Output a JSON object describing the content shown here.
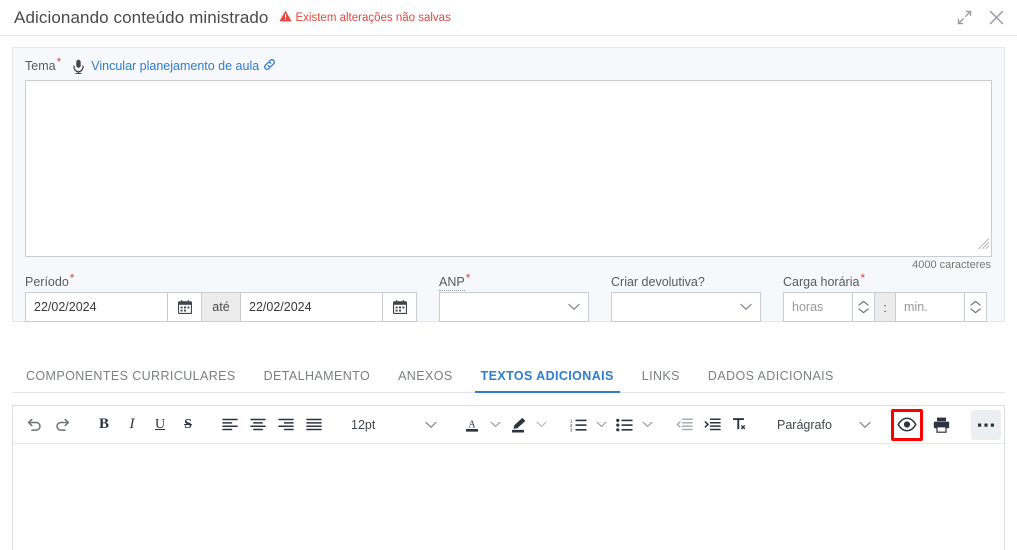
{
  "header": {
    "title": "Adicionando conteúdo ministrado",
    "unsaved_text": "Existem alterações não salvas",
    "unsaved_color": "#e8453c",
    "warning_icon": "warning-triangle-icon",
    "expand_icon": "expand-diagonal-icon",
    "close_icon": "close-x-icon"
  },
  "form": {
    "tema": {
      "label": "Tema",
      "required_mark": "*",
      "mic_icon": "microphone-icon",
      "link_label": "Vincular planejamento de aula",
      "link_icon": "chain-link-icon",
      "link_color": "#2d7dd2",
      "value": "",
      "char_counter": "4000 caracteres",
      "resize_grip_icon": "resize-grip-icon"
    },
    "periodo": {
      "label": "Período",
      "required_mark": "*",
      "start_value": "22/02/2024",
      "separator_label": "até",
      "end_value": "22/02/2024",
      "calendar_icon": "calendar-icon"
    },
    "anp": {
      "label": "ANP",
      "required_mark": "*",
      "value": "",
      "chevron_icon": "chevron-down-icon"
    },
    "devolutiva": {
      "label": "Criar devolutiva?",
      "value": "",
      "chevron_icon": "chevron-down-icon"
    },
    "carga_horaria": {
      "label": "Carga horária",
      "required_mark": "*",
      "hours_placeholder": "horas",
      "hours_value": "",
      "separator": ":",
      "minutes_placeholder": "min.",
      "minutes_value": "",
      "stepper_up_icon": "chevron-up-icon",
      "stepper_down_icon": "chevron-down-icon"
    }
  },
  "tabs": {
    "active_color": "#2d7dd2",
    "items": [
      {
        "label": "COMPONENTES CURRICULARES",
        "active": false
      },
      {
        "label": "DETALHAMENTO",
        "active": false
      },
      {
        "label": "ANEXOS",
        "active": false
      },
      {
        "label": "TEXTOS ADICIONAIS",
        "active": true
      },
      {
        "label": "LINKS",
        "active": false
      },
      {
        "label": "DADOS ADICIONAIS",
        "active": false
      }
    ]
  },
  "editor": {
    "font_size_value": "12pt",
    "block_format_value": "Parágrafo",
    "content": "",
    "highlight_color": "#ff0000",
    "buttons": {
      "undo": "undo-icon",
      "redo": "redo-icon",
      "bold": "bold-icon",
      "italic": "italic-icon",
      "underline": "underline-icon",
      "strikethrough": "strikethrough-icon",
      "align_left": "align-left-icon",
      "align_center": "align-center-icon",
      "align_right": "align-right-icon",
      "align_justify": "align-justify-icon",
      "text_color": "text-color-icon",
      "highlight_color": "highlight-pen-icon",
      "numbered_list": "numbered-list-icon",
      "bulleted_list": "bulleted-list-icon",
      "outdent": "outdent-icon",
      "indent": "indent-icon",
      "clear_format": "clear-formatting-icon",
      "preview": "eye-preview-icon",
      "print": "print-icon",
      "more": "more-options-icon"
    },
    "labels": {
      "bold": "B",
      "italic": "I",
      "underline": "U",
      "strikethrough": "S",
      "clear_format": "Tx"
    }
  }
}
